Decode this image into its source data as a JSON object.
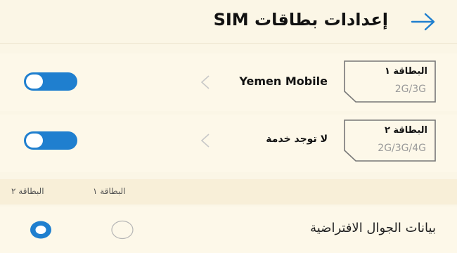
{
  "header": {
    "title": "إعدادات بطاقات SIM",
    "back_icon": "arrow-right-icon"
  },
  "sims": [
    {
      "name": "البطاقة ١",
      "tech": "2G/3G",
      "carrier": "Yemen Mobile",
      "enabled": true
    },
    {
      "name": "البطاقة ٢",
      "tech": "2G/3G/4G",
      "carrier": "لا توجد خدمة",
      "enabled": true
    }
  ],
  "columns": {
    "sim1": "البطاقة ١",
    "sim2": "البطاقة ٢"
  },
  "default_mobile_data": {
    "label": "بيانات الجوال الافتراضية",
    "selected": "البطاقة ٢"
  },
  "colors": {
    "accent": "#1f7fcf",
    "background": "#fbf6e6"
  }
}
